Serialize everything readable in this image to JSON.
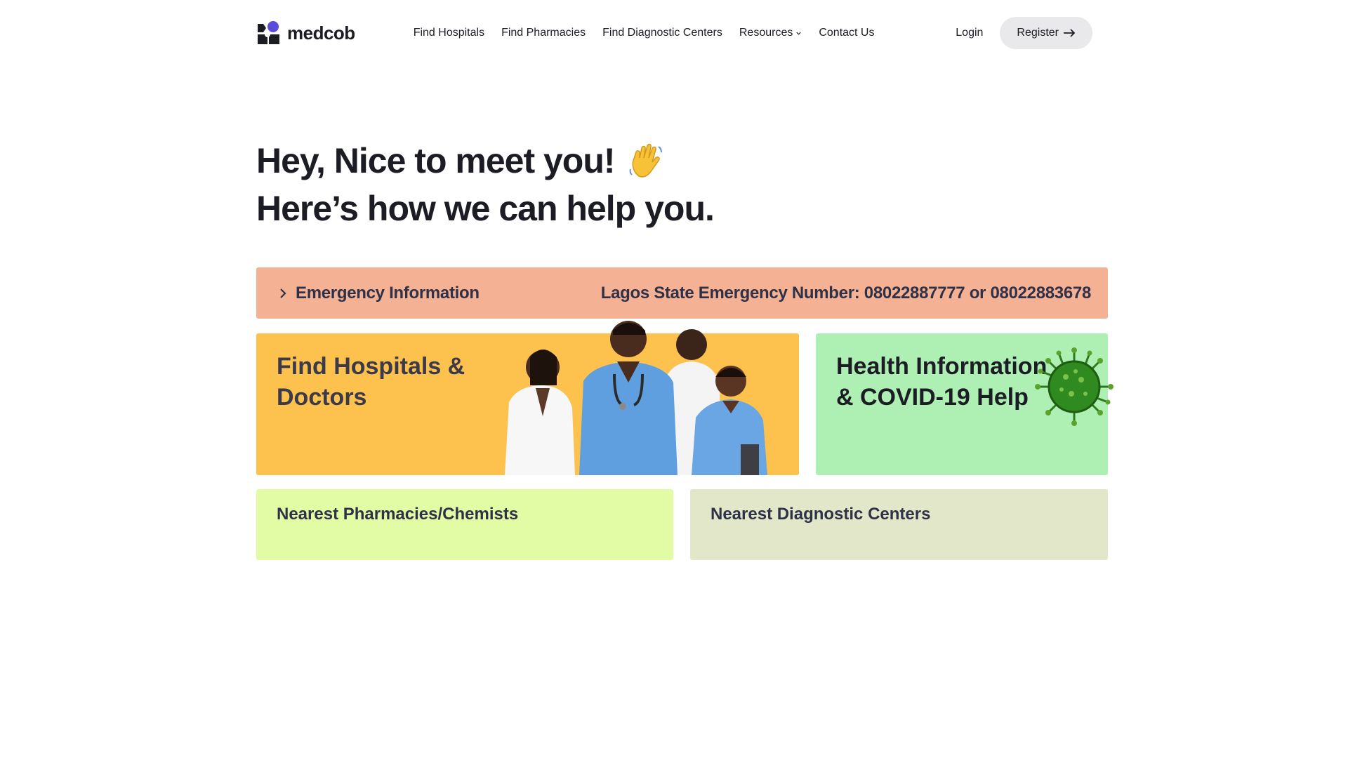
{
  "brand": {
    "name": "medcob"
  },
  "nav": {
    "items": [
      {
        "label": "Find Hospitals"
      },
      {
        "label": "Find Pharmacies"
      },
      {
        "label": "Find Diagnostic Centers"
      },
      {
        "label": "Resources"
      },
      {
        "label": "Contact Us"
      }
    ]
  },
  "auth": {
    "login": "Login",
    "register": "Register"
  },
  "hero": {
    "line1": "Hey, Nice to meet you!",
    "line2": "Here’s how we can help you."
  },
  "emergency": {
    "title": "Emergency Information",
    "number": "Lagos State Emergency Number: 08022887777 or 08022883678"
  },
  "cards": {
    "hospitals": "Find Hospitals & Doctors",
    "health": "Health Information & COVID-19 Help",
    "pharmacies": "Nearest Pharmacies/Chemists",
    "diagnostic": "Nearest Diagnostic Centers"
  },
  "colors": {
    "emergency": "#f5b194",
    "hospitals": "#fdc14e",
    "health": "#aeefb3",
    "pharmacies": "#e2fba5",
    "diagnostic": "#e3e7c9",
    "register_bg": "#e9e9eb"
  },
  "icons": {
    "logo": "medcob-logo-icon",
    "dropdown": "chevron-down-icon",
    "register": "arrow-right-icon",
    "emergency": "chevron-right-icon",
    "wave": "waving-hand-icon",
    "virus": "virus-icon"
  }
}
